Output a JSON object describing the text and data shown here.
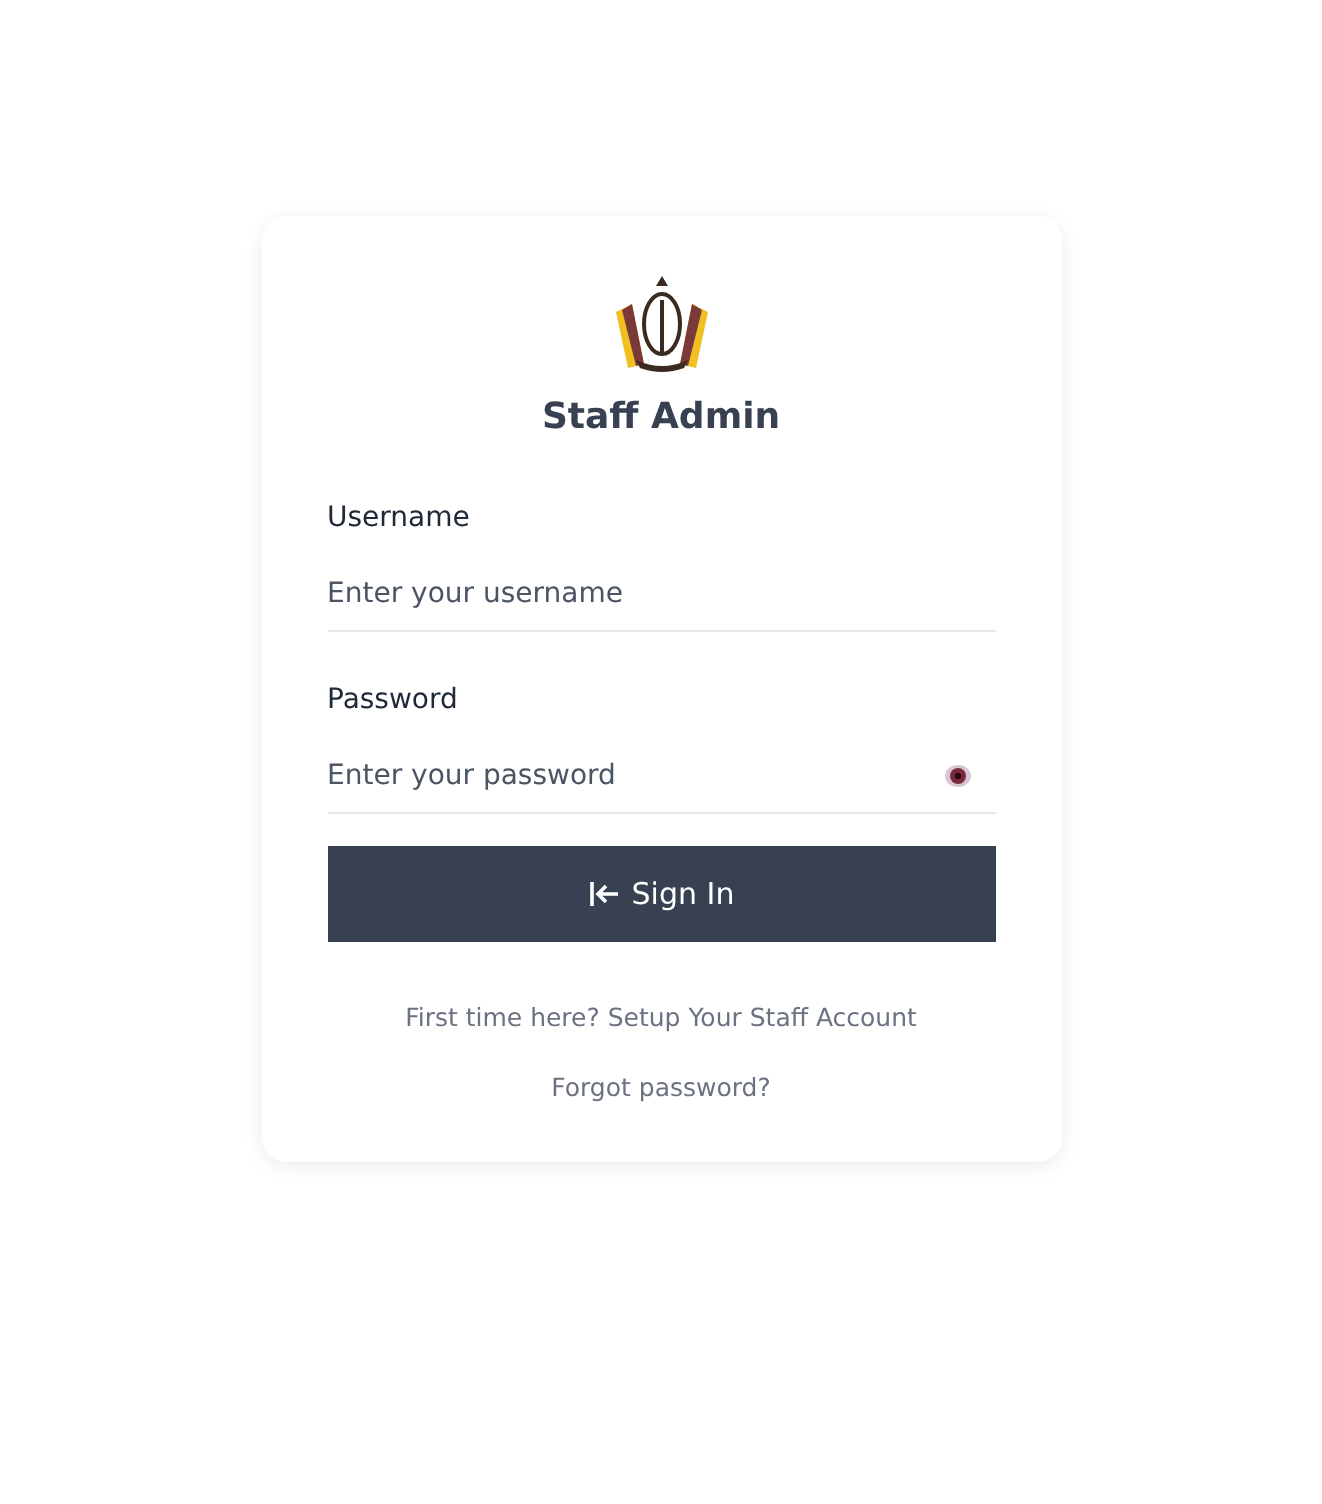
{
  "title": "Staff Admin",
  "fields": [
    {
      "label": "Username",
      "placeholder": "Enter your username",
      "kind": "text"
    },
    {
      "label": "Password",
      "placeholder": "Enter your password",
      "kind": "password"
    }
  ],
  "submit": {
    "label": "Sign In"
  },
  "links": [
    "First time here? Setup Your Staff Account",
    "Forgot password?"
  ]
}
